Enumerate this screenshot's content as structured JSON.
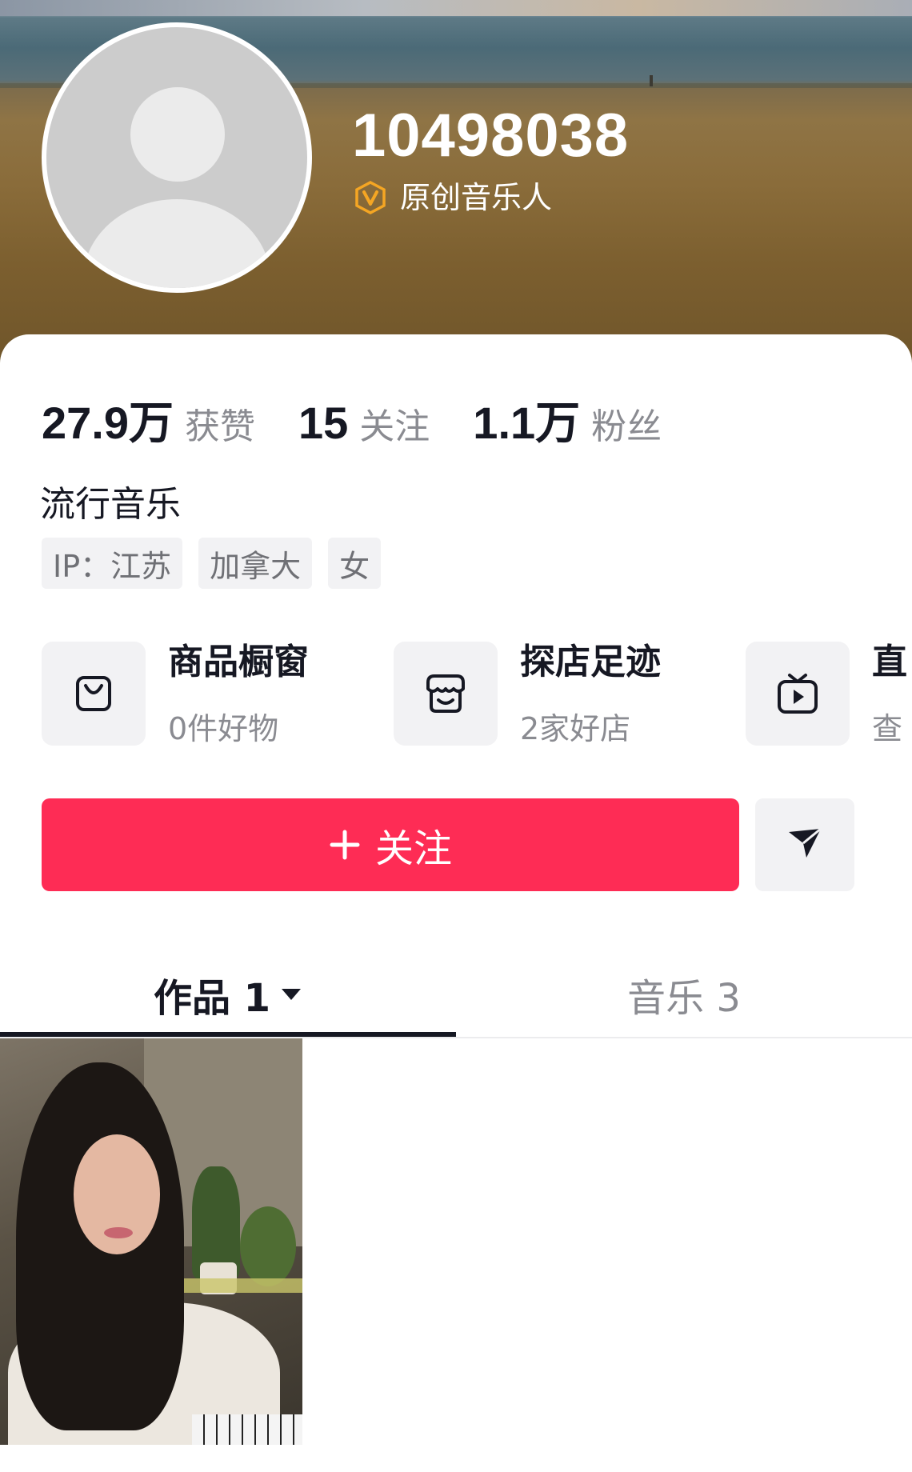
{
  "profile": {
    "username": "10498038",
    "verify_label": "原创音乐人",
    "bio": "流行音乐"
  },
  "stats": [
    {
      "value": "27.9万",
      "label": "获赞"
    },
    {
      "value": "15",
      "label": "关注"
    },
    {
      "value": "1.1万",
      "label": "粉丝"
    }
  ],
  "tags": [
    "IP：江苏",
    "加拿大",
    "女"
  ],
  "features": [
    {
      "title": "商品橱窗",
      "subtitle": "0件好物",
      "icon": "shopping-bag-icon"
    },
    {
      "title": "探店足迹",
      "subtitle": "2家好店",
      "icon": "shop-icon"
    },
    {
      "title": "直",
      "subtitle": "查",
      "icon": "tv-play-icon"
    }
  ],
  "actions": {
    "follow_label": "关注",
    "follow_color": "#fe2c55"
  },
  "tabs": [
    {
      "label": "作品 1",
      "active": true
    },
    {
      "label": "音乐 3",
      "active": false
    }
  ],
  "colors": {
    "accent": "#fe2c55",
    "verify_gold": "#f5a623",
    "text_primary": "#161823",
    "text_secondary": "#8a8b91"
  }
}
